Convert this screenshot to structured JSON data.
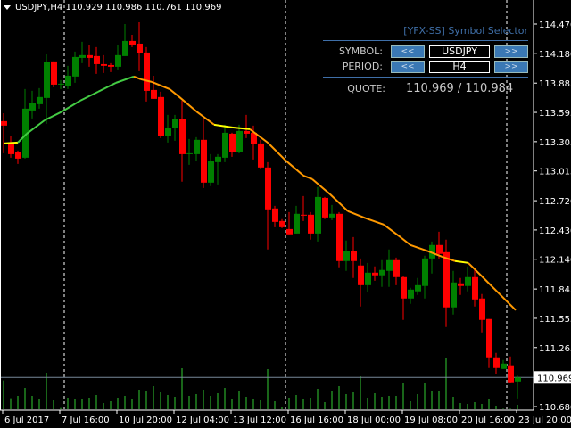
{
  "header": {
    "symbol_tf": "USDJPY,H4",
    "ohlc": "110.929 110.986 110.761 110.969"
  },
  "panel": {
    "title": "[YFX-SS] Symbol Selector",
    "symbol_label": "SYMBOL:",
    "symbol_value": "USDJPY",
    "period_label": "PERIOD:",
    "period_value": "H4",
    "prev_label": "<<",
    "next_label": ">>",
    "quote_label": "QUOTE:",
    "quote_value": "110.969 / 110.984",
    "accent": "#3f6fa8"
  },
  "chart_data": {
    "type": "candlestick",
    "symbol": "USDJPY",
    "timeframe": "H4",
    "ylim": [
      110.68,
      114.47
    ],
    "price_ticks": [
      "114.470",
      "114.180",
      "113.885",
      "113.595",
      "113.305",
      "113.015",
      "112.720",
      "112.430",
      "112.140",
      "111.845",
      "111.555",
      "111.265",
      "110.680"
    ],
    "current_price": "110.969",
    "time_labels": [
      {
        "i": 0,
        "label": "6 Jul 2017"
      },
      {
        "i": 8,
        "label": "7 Jul 16:00"
      },
      {
        "i": 16,
        "label": "10 Jul 20:00"
      },
      {
        "i": 24,
        "label": "12 Jul 04:00"
      },
      {
        "i": 32,
        "label": "13 Jul 12:00"
      },
      {
        "i": 40,
        "label": "16 Jul 16:00"
      },
      {
        "i": 48,
        "label": "18 Jul 00:00"
      },
      {
        "i": 56,
        "label": "19 Jul 08:00"
      },
      {
        "i": 64,
        "label": "20 Jul 16:00"
      },
      {
        "i": 72,
        "label": "23 Jul 20:00"
      }
    ],
    "separators": [
      9,
      40,
      71
    ],
    "up_color": "#008000",
    "down_color": "#ff0000",
    "ohlc": [
      [
        113.508,
        113.587,
        113.19,
        113.464
      ],
      [
        113.296,
        113.358,
        113.146,
        113.181
      ],
      [
        113.199,
        113.217,
        113.084,
        113.137
      ],
      [
        113.146,
        113.826,
        113.137,
        113.632
      ],
      [
        113.614,
        113.808,
        113.535,
        113.685
      ],
      [
        113.676,
        113.835,
        113.632,
        113.747
      ],
      [
        113.738,
        114.17,
        113.482,
        114.091
      ],
      [
        114.1,
        114.1,
        113.844,
        113.87
      ],
      [
        113.87,
        113.914,
        113.826,
        113.879
      ],
      [
        113.853,
        114.056,
        113.826,
        113.958
      ],
      [
        113.95,
        114.197,
        113.888,
        114.144
      ],
      [
        114.135,
        114.294,
        114.082,
        114.162
      ],
      [
        114.162,
        114.259,
        114.047,
        114.135
      ],
      [
        114.153,
        114.241,
        113.976,
        114.073
      ],
      [
        114.073,
        114.162,
        113.985,
        114.056
      ],
      [
        114.064,
        114.082,
        113.994,
        114.047
      ],
      [
        114.047,
        114.259,
        114.02,
        114.162
      ],
      [
        114.153,
        114.47,
        114.153,
        114.303
      ],
      [
        114.303,
        114.364,
        114.241,
        114.267
      ],
      [
        114.276,
        114.488,
        114.003,
        114.179
      ],
      [
        114.188,
        114.241,
        113.702,
        113.808
      ],
      [
        113.817,
        113.958,
        113.729,
        113.729
      ],
      [
        113.747,
        113.8,
        113.34,
        113.358
      ],
      [
        113.358,
        113.57,
        113.296,
        113.437
      ],
      [
        113.437,
        113.57,
        113.314,
        113.526
      ],
      [
        113.526,
        113.711,
        112.908,
        113.181
      ],
      [
        113.181,
        113.331,
        113.075,
        113.19
      ],
      [
        113.181,
        113.349,
        113.111,
        113.323
      ],
      [
        113.323,
        113.526,
        112.846,
        112.899
      ],
      [
        112.899,
        113.181,
        112.864,
        113.111
      ],
      [
        113.102,
        113.181,
        112.881,
        113.155
      ],
      [
        113.146,
        113.473,
        113.102,
        113.393
      ],
      [
        113.384,
        113.393,
        113.155,
        113.199
      ],
      [
        113.199,
        113.473,
        113.19,
        113.411
      ],
      [
        113.411,
        113.57,
        113.34,
        113.384
      ],
      [
        113.393,
        113.464,
        113.128,
        113.278
      ],
      [
        113.287,
        113.323,
        113.04,
        113.049
      ],
      [
        113.049,
        113.102,
        112.237,
        112.634
      ],
      [
        112.643,
        112.669,
        112.457,
        112.51
      ],
      [
        112.519,
        112.537,
        112.448,
        112.457
      ],
      [
        112.439,
        112.607,
        112.387,
        112.387
      ],
      [
        112.395,
        112.669,
        112.395,
        112.59
      ],
      [
        112.581,
        112.766,
        112.519,
        112.572
      ],
      [
        112.581,
        112.607,
        112.334,
        112.395
      ],
      [
        112.395,
        112.855,
        112.316,
        112.757
      ],
      [
        112.748,
        112.757,
        112.537,
        112.554
      ],
      [
        112.554,
        112.678,
        112.528,
        112.59
      ],
      [
        112.59,
        112.607,
        112.06,
        112.122
      ],
      [
        112.122,
        112.325,
        112.025,
        112.219
      ],
      [
        112.219,
        112.36,
        111.954,
        112.122
      ],
      [
        112.078,
        112.148,
        111.672,
        111.883
      ],
      [
        111.883,
        112.104,
        111.813,
        112.007
      ],
      [
        112.007,
        112.069,
        111.927,
        111.981
      ],
      [
        111.981,
        112.131,
        111.866,
        112.034
      ],
      [
        112.025,
        112.237,
        111.866,
        112.131
      ],
      [
        112.131,
        112.157,
        111.883,
        111.963
      ],
      [
        111.963,
        111.972,
        111.539,
        111.751
      ],
      [
        111.751,
        111.857,
        111.698,
        111.839
      ],
      [
        111.822,
        111.954,
        111.786,
        111.883
      ],
      [
        111.875,
        112.175,
        111.751,
        112.148
      ],
      [
        112.148,
        112.316,
        111.998,
        112.281
      ],
      [
        112.281,
        112.413,
        112.148,
        112.193
      ],
      [
        112.21,
        112.334,
        111.468,
        111.663
      ],
      [
        111.663,
        112.025,
        111.592,
        111.91
      ],
      [
        111.901,
        111.954,
        111.786,
        111.875
      ],
      [
        111.875,
        112.069,
        111.822,
        111.963
      ],
      [
        111.963,
        112.051,
        111.672,
        111.742
      ],
      [
        111.751,
        111.795,
        111.415,
        111.539
      ],
      [
        111.548,
        111.548,
        111.062,
        111.168
      ],
      [
        111.168,
        111.212,
        111.0,
        111.062
      ],
      [
        111.053,
        111.142,
        111.053,
        111.106
      ],
      [
        111.089,
        111.177,
        110.912,
        110.921
      ],
      [
        110.929,
        110.986,
        110.761,
        110.969
      ]
    ],
    "volume": [
      97,
      37,
      45,
      72,
      45,
      36,
      123,
      30,
      4,
      39,
      36,
      36,
      39,
      48,
      21,
      27,
      39,
      45,
      33,
      66,
      60,
      78,
      57,
      48,
      42,
      138,
      45,
      51,
      66,
      45,
      54,
      72,
      36,
      60,
      42,
      33,
      30,
      135,
      27,
      9,
      39,
      48,
      33,
      39,
      69,
      24,
      63,
      78,
      51,
      57,
      111,
      39,
      54,
      42,
      45,
      45,
      90,
      27,
      51,
      87,
      60,
      60,
      171,
      42,
      21,
      18,
      24,
      18,
      33,
      12,
      2,
      2,
      15
    ],
    "ma": [
      [
        0,
        113.287
      ],
      [
        2,
        113.296
      ],
      [
        3.25,
        113.384
      ],
      [
        5.75,
        113.517
      ],
      [
        8.25,
        113.605
      ],
      [
        10.75,
        113.711
      ],
      [
        13.25,
        113.8
      ],
      [
        15.75,
        113.888
      ],
      [
        18.25,
        113.95
      ],
      [
        19.25,
        113.923
      ],
      [
        20.75,
        113.897
      ],
      [
        23.25,
        113.826
      ],
      [
        24.5,
        113.755
      ],
      [
        27,
        113.605
      ],
      [
        29.5,
        113.473
      ],
      [
        32,
        113.446
      ],
      [
        34.5,
        113.429
      ],
      [
        37,
        113.296
      ],
      [
        39.5,
        113.12
      ],
      [
        42,
        112.969
      ],
      [
        43.25,
        112.934
      ],
      [
        45.75,
        112.784
      ],
      [
        48.25,
        112.616
      ],
      [
        50.75,
        112.546
      ],
      [
        53.25,
        112.484
      ],
      [
        55.75,
        112.351
      ],
      [
        57,
        112.281
      ],
      [
        59.5,
        112.219
      ],
      [
        61.4,
        112.166
      ],
      [
        63.25,
        112.122
      ],
      [
        65.1,
        112.104
      ],
      [
        67,
        111.972
      ],
      [
        69.5,
        111.795
      ],
      [
        71.75,
        111.636
      ]
    ],
    "ma_colors": {
      "rising": "#44cc44",
      "flat": "#ffff00",
      "falling": "#ff9900"
    }
  }
}
